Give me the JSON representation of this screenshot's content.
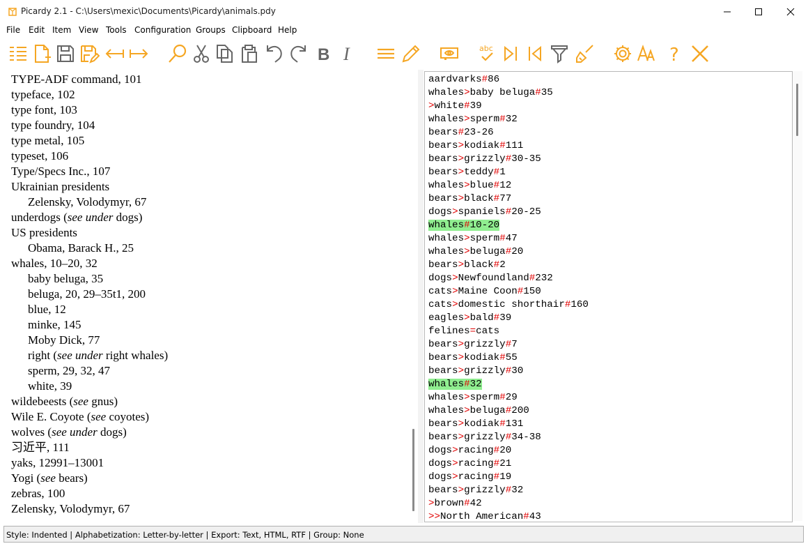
{
  "window": {
    "title": "Picardy 2.1 - C:\\Users\\mexic\\Documents\\Picardy\\animals.pdy",
    "accent_color": "#f5a623"
  },
  "menu": [
    "File",
    "Edit",
    "Item",
    "View",
    "Tools",
    "Configuration",
    "Groups",
    "Clipboard",
    "Help"
  ],
  "toolbar": {
    "icons": [
      "list-outline-icon",
      "new-file-icon",
      "save-icon",
      "save-as-icon",
      "swap-left-icon",
      "swap-right-icon",
      "search-icon",
      "cut-icon",
      "copy-icon",
      "paste-icon",
      "undo-icon",
      "redo-icon",
      "bold-icon",
      "italic-icon",
      "menu-lines-icon",
      "pencil-icon",
      "preview-icon",
      "spellcheck-icon",
      "next-icon",
      "previous-icon",
      "filter-icon",
      "clear-icon",
      "settings-icon",
      "font-size-icon",
      "help-icon",
      "close-icon"
    ],
    "spellcheck_label": "abc"
  },
  "index_lines": [
    {
      "indent": 0,
      "parts": [
        {
          "t": "TYPE-ADF command, 101"
        }
      ]
    },
    {
      "indent": 0,
      "parts": [
        {
          "t": "typeface, 102"
        }
      ]
    },
    {
      "indent": 0,
      "parts": [
        {
          "t": "type font, 103"
        }
      ]
    },
    {
      "indent": 0,
      "parts": [
        {
          "t": "type foundry, 104"
        }
      ]
    },
    {
      "indent": 0,
      "parts": [
        {
          "t": "type metal, 105"
        }
      ]
    },
    {
      "indent": 0,
      "parts": [
        {
          "t": "typeset, 106"
        }
      ]
    },
    {
      "indent": 0,
      "parts": [
        {
          "t": "Type/Specs Inc., 107"
        }
      ]
    },
    {
      "indent": 0,
      "parts": [
        {
          "t": "Ukrainian presidents"
        }
      ]
    },
    {
      "indent": 1,
      "parts": [
        {
          "t": "Zelensky, Volodymyr, 67"
        }
      ]
    },
    {
      "indent": 0,
      "parts": [
        {
          "t": "underdogs ("
        },
        {
          "t": "see under",
          "i": true
        },
        {
          "t": " dogs)"
        }
      ]
    },
    {
      "indent": 0,
      "parts": [
        {
          "t": "US presidents"
        }
      ]
    },
    {
      "indent": 1,
      "parts": [
        {
          "t": "Obama, Barack H., 25"
        }
      ]
    },
    {
      "indent": 0,
      "parts": [
        {
          "t": "whales, 10–20, 32"
        }
      ]
    },
    {
      "indent": 1,
      "parts": [
        {
          "t": "baby beluga, 35"
        }
      ]
    },
    {
      "indent": 1,
      "parts": [
        {
          "t": "beluga, 20, 29–35t1, 200"
        }
      ]
    },
    {
      "indent": 1,
      "parts": [
        {
          "t": "blue, 12"
        }
      ]
    },
    {
      "indent": 1,
      "parts": [
        {
          "t": "minke, 145"
        }
      ]
    },
    {
      "indent": 1,
      "parts": [
        {
          "t": "Moby Dick, 77"
        }
      ]
    },
    {
      "indent": 1,
      "parts": [
        {
          "t": "right ("
        },
        {
          "t": "see under",
          "i": true
        },
        {
          "t": " right whales)"
        }
      ]
    },
    {
      "indent": 1,
      "parts": [
        {
          "t": "sperm, 29, 32, 47"
        }
      ]
    },
    {
      "indent": 1,
      "parts": [
        {
          "t": "white, 39"
        }
      ]
    },
    {
      "indent": 0,
      "parts": [
        {
          "t": "wildebeests ("
        },
        {
          "t": "see",
          "i": true
        },
        {
          "t": " gnus)"
        }
      ]
    },
    {
      "indent": 0,
      "parts": [
        {
          "t": "Wile E. Coyote ("
        },
        {
          "t": "see",
          "i": true
        },
        {
          "t": " coyotes)"
        }
      ]
    },
    {
      "indent": 0,
      "parts": [
        {
          "t": "wolves ("
        },
        {
          "t": "see under",
          "i": true
        },
        {
          "t": " dogs)"
        }
      ]
    },
    {
      "indent": 0,
      "parts": [
        {
          "t": "习近平, 111"
        }
      ]
    },
    {
      "indent": 0,
      "parts": [
        {
          "t": "yaks, 12991–13001"
        }
      ]
    },
    {
      "indent": 0,
      "parts": [
        {
          "t": "Yogi ("
        },
        {
          "t": "see",
          "i": true
        },
        {
          "t": " bears)"
        }
      ]
    },
    {
      "indent": 0,
      "parts": [
        {
          "t": "zebras, 100"
        }
      ]
    },
    {
      "indent": 0,
      "parts": [
        {
          "t": "Zelensky, Volodymyr, 67"
        }
      ]
    }
  ],
  "source_lines": [
    {
      "text": "aardvarks#86"
    },
    {
      "text": "whales>baby beluga#35"
    },
    {
      "text": ">white#39"
    },
    {
      "text": "whales>sperm#32"
    },
    {
      "text": "bears#23-26"
    },
    {
      "text": "bears>kodiak#111"
    },
    {
      "text": "bears>grizzly#30-35"
    },
    {
      "text": "bears>teddy#1"
    },
    {
      "text": "whales>blue#12"
    },
    {
      "text": "bears>black#77"
    },
    {
      "text": "dogs>spaniels#20-25"
    },
    {
      "text": "whales#10-20",
      "highlight": true
    },
    {
      "text": "whales>sperm#47"
    },
    {
      "text": "whales>beluga#20"
    },
    {
      "text": "bears>black#2"
    },
    {
      "text": "dogs>Newfoundland#232"
    },
    {
      "text": "cats>Maine Coon#150"
    },
    {
      "text": "cats>domestic shorthair#160"
    },
    {
      "text": "eagles>bald#39"
    },
    {
      "text": "felines=cats"
    },
    {
      "text": "bears>grizzly#7"
    },
    {
      "text": "bears>kodiak#55"
    },
    {
      "text": "bears>grizzly#30"
    },
    {
      "text": "whales#32",
      "highlight": true
    },
    {
      "text": "whales>sperm#29"
    },
    {
      "text": "whales>beluga#200"
    },
    {
      "text": "bears>kodiak#131"
    },
    {
      "text": "bears>grizzly#34-38"
    },
    {
      "text": "dogs>racing#20"
    },
    {
      "text": "dogs>racing#21"
    },
    {
      "text": "dogs>racing#19"
    },
    {
      "text": "bears>grizzly#32"
    },
    {
      "text": ">brown#42"
    },
    {
      "text": ">>North American#43"
    }
  ],
  "highlight_color": "#90ee90",
  "operator_color": "#e00000",
  "status": "Style: Indented | Alphabetization: Letter-by-letter | Export: Text, HTML, RTF | Group: None"
}
